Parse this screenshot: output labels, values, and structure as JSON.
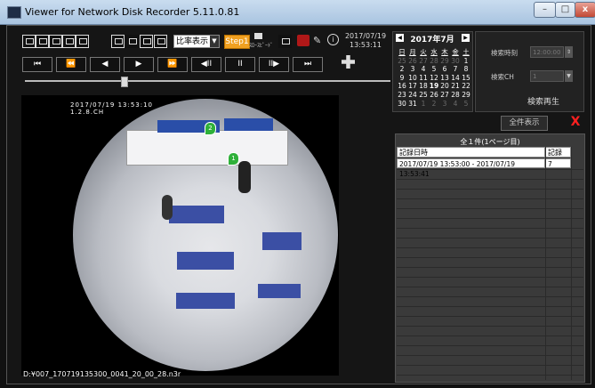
{
  "window": {
    "title": "Viewer for Network Disk Recorder 5.11.0.81",
    "minimize": "–",
    "maximize": "□",
    "close": "x"
  },
  "toolbar": {
    "ratio_select": "比率表示",
    "step_button": "Step1",
    "slow_label": "ｽﾛｰｽﾋﾟｰﾄﾞ",
    "date": "2017/07/19",
    "time": "13:53:11"
  },
  "playback": {
    "buttons": [
      "⏮",
      "⏪",
      "◀",
      "▶",
      "⏩",
      "◀II",
      "II",
      "II▶",
      "⏭"
    ]
  },
  "video": {
    "osd_datetime": "2017/07/19   13:53:10",
    "osd_channel": "1.2.8.CH",
    "file_path": "D:¥007_170719135300_0041_20_00_28.n3r",
    "marker_1": "1",
    "marker_2": "2"
  },
  "calendar": {
    "month_label": "2017年7月",
    "prev": "◀",
    "next": "▶",
    "weekdays": [
      "日",
      "月",
      "火",
      "水",
      "木",
      "金",
      "土"
    ],
    "weeks": [
      [
        "25",
        "26",
        "27",
        "28",
        "29",
        "30",
        "1"
      ],
      [
        "2",
        "3",
        "4",
        "5",
        "6",
        "7",
        "8"
      ],
      [
        "9",
        "10",
        "11",
        "12",
        "13",
        "14",
        "15"
      ],
      [
        "16",
        "17",
        "18",
        "19",
        "20",
        "21",
        "22"
      ],
      [
        "23",
        "24",
        "25",
        "26",
        "27",
        "28",
        "29"
      ],
      [
        "30",
        "31",
        "1",
        "2",
        "3",
        "4",
        "5"
      ]
    ],
    "selected_day": "19"
  },
  "search": {
    "time_label": "検索時刻",
    "time_value": "12:00:00",
    "ch_label": "検索CH",
    "ch_value": "1",
    "play_button": "検索再生"
  },
  "results": {
    "show_all": "全件表示",
    "close": "X",
    "count_label": "全１件(1ページ目)",
    "col_datetime": "記録日時",
    "col_ch": "記録CH",
    "rows": [
      {
        "datetime": "2017/07/19 13:53:00 - 2017/07/19 13:53:41",
        "ch": "7"
      }
    ]
  }
}
